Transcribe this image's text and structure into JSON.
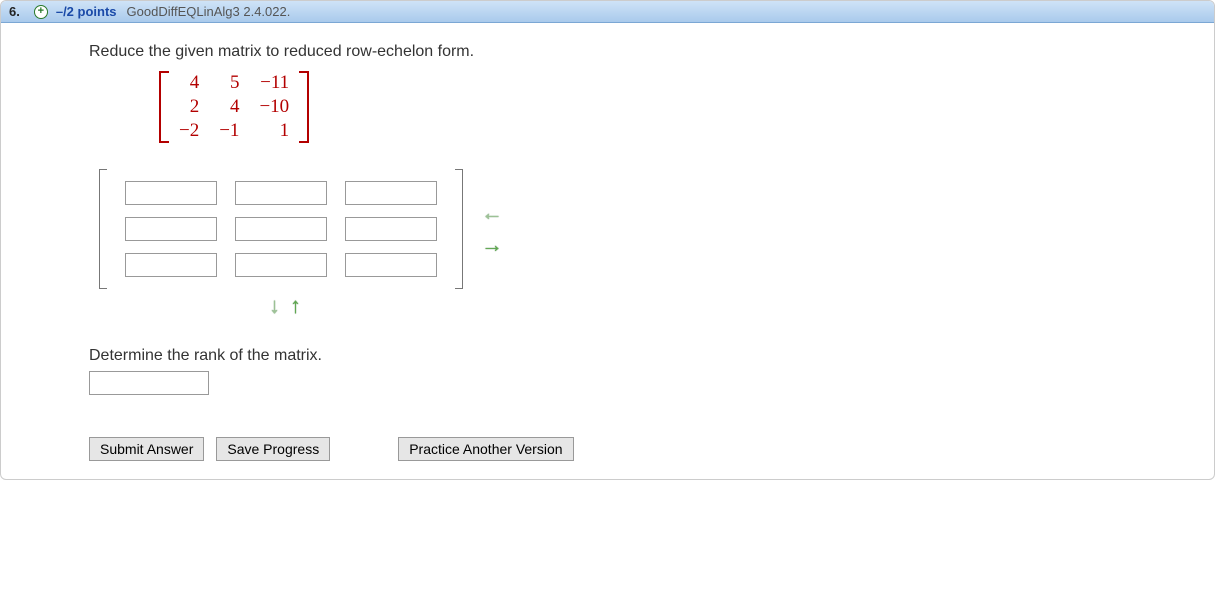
{
  "header": {
    "number": "6.",
    "expand_glyph": "+",
    "points": "–/2 points",
    "source": "GoodDiffEQLinAlg3 2.4.022."
  },
  "prompt1": "Reduce the given matrix to reduced row-echelon form.",
  "matrix": {
    "r0c0": "4",
    "r0c1": "5",
    "r0c2": "−11",
    "r1c0": "2",
    "r1c1": "4",
    "r1c2": "−10",
    "r2c0": "−2",
    "r2c1": "−1",
    "r2c2": "1"
  },
  "answer_grid": {
    "rows": 3,
    "cols": 3
  },
  "arrows": {
    "col_decrease": "←",
    "col_increase": "→",
    "row_increase": "↓",
    "row_decrease": "↑"
  },
  "prompt2": "Determine the rank of the matrix.",
  "buttons": {
    "submit": "Submit Answer",
    "save": "Save Progress",
    "practice": "Practice Another Version"
  }
}
